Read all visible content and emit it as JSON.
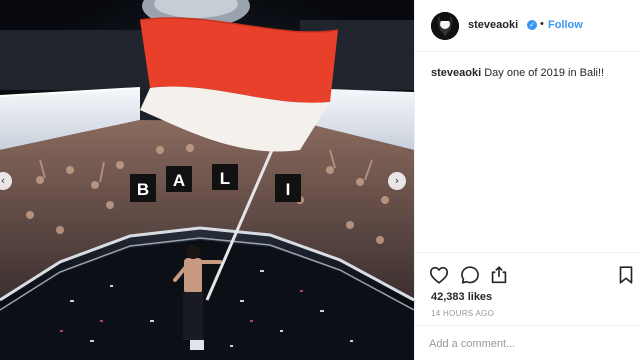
{
  "post": {
    "author": {
      "username": "steveaoki",
      "verified": true,
      "follow_label": "Follow",
      "separator": "•"
    },
    "caption": {
      "username": "steveaoki",
      "text": "Day one of 2019 in Bali!!"
    },
    "photo": {
      "sign_letters": [
        "B",
        "A",
        "L",
        "I"
      ],
      "flag_colors": {
        "top": "#e8402a",
        "bottom": "#f4f1ec"
      },
      "nav": {
        "prev": "‹",
        "next": "›"
      }
    },
    "likes": "42,383 likes",
    "timestamp": "14 HOURS AGO",
    "comment": {
      "placeholder": "Add a comment..."
    }
  },
  "colors": {
    "accent": "#3897f0",
    "text": "#262626",
    "muted": "#999999",
    "divider": "#efefef"
  },
  "icons": [
    "heart-icon",
    "comment-icon",
    "share-icon",
    "bookmark-icon",
    "verified-badge-icon"
  ]
}
